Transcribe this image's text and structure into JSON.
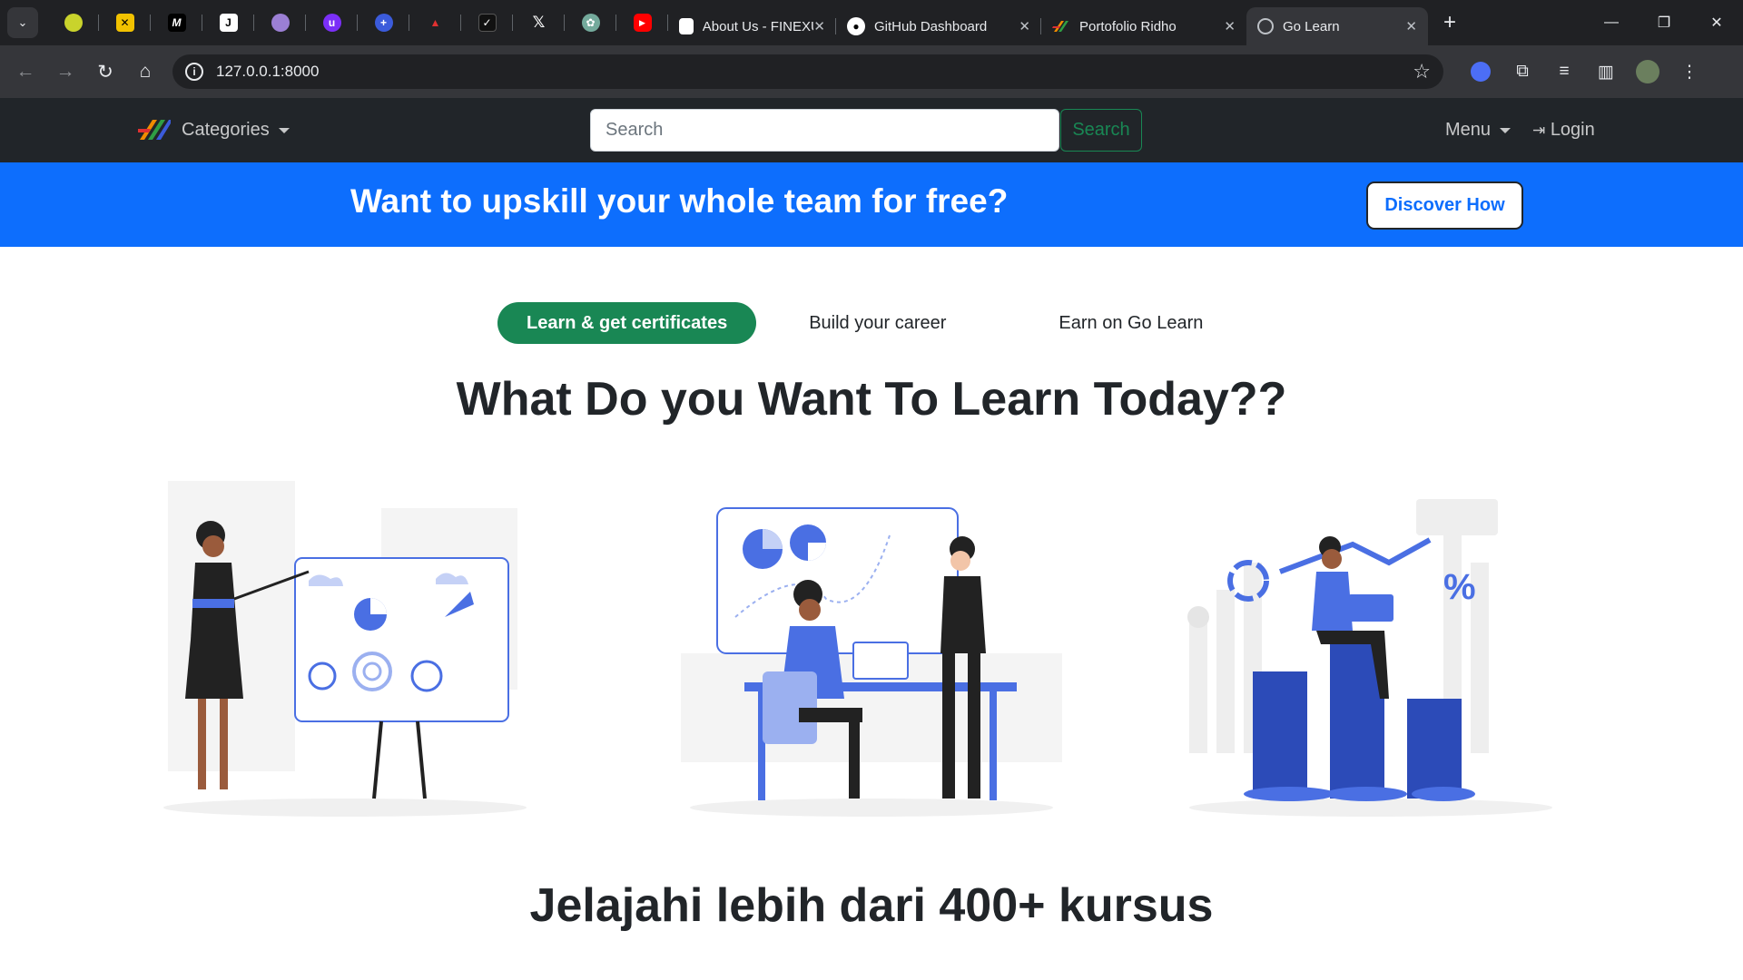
{
  "browser": {
    "tabs": [
      {
        "title": "About Us - FINEXUS"
      },
      {
        "title": "GitHub Dashboard"
      },
      {
        "title": "Portofolio Ridho"
      },
      {
        "title": "Go Learn"
      }
    ],
    "url": "127.0.0.1:8000"
  },
  "navbar": {
    "categories_label": "Categories",
    "search_placeholder": "Search",
    "search_button": "Search",
    "menu_label": "Menu",
    "login_label": "Login"
  },
  "banner": {
    "text": "Want to upskill your whole team for free?",
    "button": "Discover How",
    "color": "#0d6efd"
  },
  "tabs": {
    "items": [
      {
        "label": "Learn & get certificates"
      },
      {
        "label": "Build your career"
      },
      {
        "label": "Earn on Go Learn"
      }
    ]
  },
  "main": {
    "headline": "What Do you Want To Learn Today??",
    "subheadline": "Jelajahi lebih dari 400+ kursus"
  },
  "colors": {
    "accent": "#198754",
    "primary": "#0d6efd",
    "illustration": "#4a6fe3",
    "dark": "#212529"
  }
}
